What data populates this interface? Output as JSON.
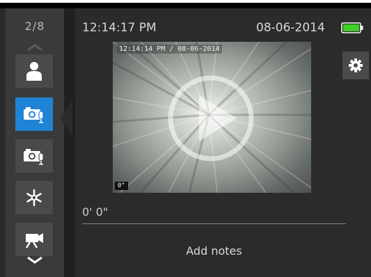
{
  "header": {
    "time": "12:14:17 PM",
    "date": "08-06-2014",
    "battery_icon": "battery-full-icon",
    "battery_color": "#3ccf24"
  },
  "sidebar": {
    "page_counter": "2/8",
    "active_color": "#1f84d6",
    "buttons": [
      {
        "icon": "person-icon",
        "active": false
      },
      {
        "icon": "camera-mic-icon",
        "active": true
      },
      {
        "icon": "camera-mic-icon",
        "active": false
      },
      {
        "icon": "light-burst-icon",
        "active": false
      },
      {
        "icon": "video-camera-icon",
        "active": false
      }
    ]
  },
  "settings": {
    "icon": "gear-icon"
  },
  "video": {
    "timestamp": "12:14:14 PM / 08-06-2014",
    "depth_badge": "0\"",
    "play_icon": "play-icon"
  },
  "depth": "0' 0\"",
  "notes_label": "Add notes"
}
